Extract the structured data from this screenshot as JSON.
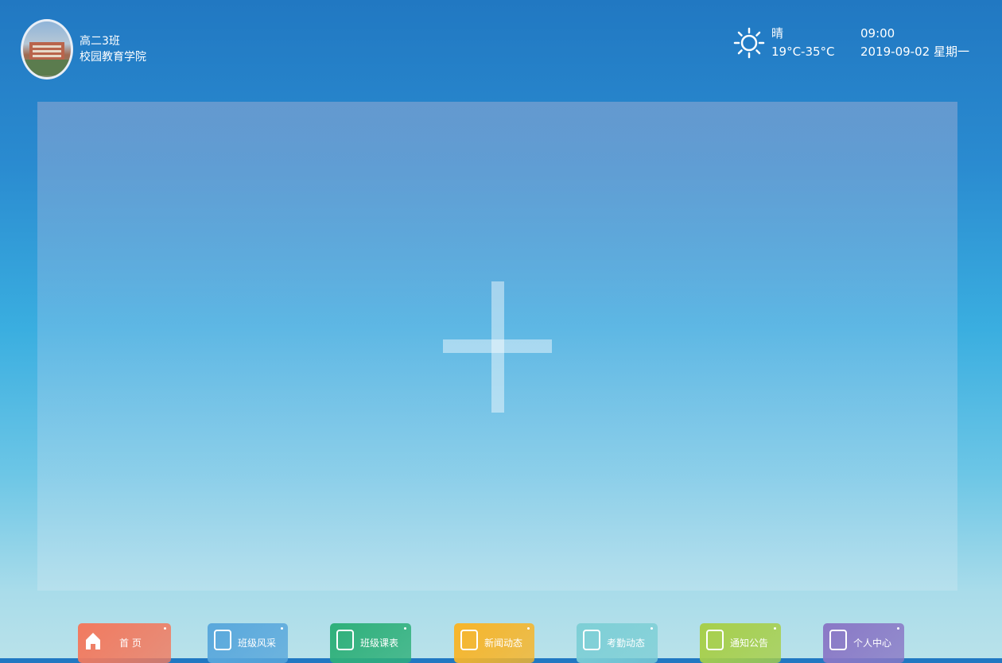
{
  "header": {
    "class_name": "高二3班",
    "school_name": "校园教育学院",
    "weather": {
      "condition": "晴",
      "temperature": "19°C-35°C",
      "icon": "sun-icon"
    },
    "time": "09:00",
    "date": "2019-09-02 星期一"
  },
  "main": {
    "add_icon": "plus-icon"
  },
  "nav": {
    "items": [
      {
        "label": "首 页",
        "icon": "home-icon",
        "color": "#f27a5f"
      },
      {
        "label": "班级风采",
        "icon": "image-icon",
        "color": "#5aa8dc"
      },
      {
        "label": "班级课表",
        "icon": "timetable-icon",
        "color": "#2fb07a"
      },
      {
        "label": "新闻动态",
        "icon": "news-icon",
        "color": "#f7b52a"
      },
      {
        "label": "考勤动态",
        "icon": "attendance-icon",
        "color": "#7ecfd6"
      },
      {
        "label": "通知公告",
        "icon": "notice-icon",
        "color": "#a7cf4a"
      },
      {
        "label": "个人中心",
        "icon": "profile-icon",
        "color": "#8a78c6"
      }
    ]
  }
}
